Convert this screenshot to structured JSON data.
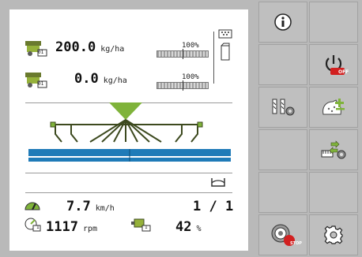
{
  "colors": {
    "background": "#b9b9b9",
    "panel": "#ffffff",
    "side_button": "#bfbfbf",
    "green": "#7fb33a",
    "olive": "#4d5a2a",
    "boom_blue": "#1f7bb8",
    "stop_red": "#d22020"
  },
  "rates": [
    {
      "icon": "seed-meter-1-icon",
      "value": "200.0",
      "unit": "kg/ha",
      "percent": "100%",
      "meter_badge": "01"
    },
    {
      "icon": "seed-meter-2-icon",
      "value": "0.0",
      "unit": "kg/ha",
      "percent": "100%",
      "meter_badge": "01"
    }
  ],
  "hopper": {
    "icon": "hopper-icon"
  },
  "machine": {
    "icon": "seed-drill-boom-icon"
  },
  "tramline": {
    "icon": "tramline-marker-icon",
    "value": "1 / 1"
  },
  "speed": {
    "icon": "speedometer-icon",
    "value": "7.7",
    "unit": "km/h"
  },
  "fan": {
    "icon": "fan-speed-icon",
    "value": "1117",
    "unit": "rpm",
    "badge": "1"
  },
  "fill": {
    "icon": "fill-level-icon",
    "value": "42",
    "unit": "%",
    "badge": "1"
  },
  "softkeys": [
    {
      "name": "info-button",
      "icon": "info-icon"
    },
    {
      "name": "empty-softkey-1",
      "icon": ""
    },
    {
      "name": "empty-softkey-2",
      "icon": ""
    },
    {
      "name": "power-off-button",
      "icon": "power-off-icon",
      "badge": "OFF"
    },
    {
      "name": "tramline-settings-button",
      "icon": "tramline-settings-icon"
    },
    {
      "name": "add-seed-button",
      "icon": "add-seed-icon"
    },
    {
      "name": "empty-softkey-3",
      "icon": ""
    },
    {
      "name": "transfer-settings-button",
      "icon": "transfer-settings-icon"
    },
    {
      "name": "empty-softkey-4",
      "icon": ""
    },
    {
      "name": "empty-softkey-5",
      "icon": ""
    },
    {
      "name": "metering-stop-button",
      "icon": "metering-stop-icon",
      "badge": "STOP"
    },
    {
      "name": "settings-button",
      "icon": "gear-icon"
    }
  ]
}
